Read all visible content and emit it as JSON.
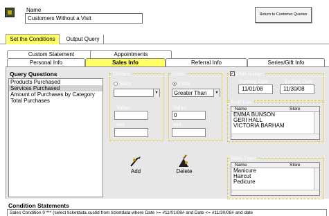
{
  "header": {
    "name_label": "Name",
    "name_value": "Customers Without a Visit",
    "return_button": "Return to Customer Queries"
  },
  "top_tabs": {
    "conditions": "Set the Conditions",
    "output": "Output Query"
  },
  "section_tabs": {
    "custom_statement": "Custom Statement",
    "appointments": "Appointments",
    "personal_info": "Personal Info",
    "sales_info": "Sales Info",
    "referral_info": "Referral Info",
    "series_gift_info": "Series/Gift Info"
  },
  "query_questions": {
    "title": "Query Questions",
    "items": [
      {
        "label": "Products Purchased",
        "selected": false
      },
      {
        "label": "Services Purchased",
        "selected": true
      },
      {
        "label": "Amount of Purchases by Category",
        "selected": false
      },
      {
        "label": "Total Purchases",
        "selected": false
      }
    ]
  },
  "dollars": {
    "title": "Dollars:",
    "radio_label": "Sales",
    "value_label": "Value:",
    "and_label": "and"
  },
  "units": {
    "title": "Units:",
    "radio_label": "Units",
    "operator": "Greater Than",
    "value_label": "Value:",
    "value": "0",
    "and_label": "and"
  },
  "date_range": {
    "title": "Date Range:",
    "checked": true,
    "start_label": "Starting Date",
    "end_label": "Ending Date",
    "start_value": "11/01/08",
    "end_value": "11/30/08"
  },
  "staff_list": {
    "title": "Staff List:",
    "columns": [
      "Name",
      "Store"
    ],
    "rows": [
      "EMMA BUNSON",
      "GERI HALL",
      "VICTORIA BARHAM"
    ]
  },
  "sales_type": {
    "title": "Sales Type:",
    "columns": [
      "Name",
      "Store"
    ],
    "rows": [
      "Manicure",
      "Haircut",
      "Pedicure"
    ]
  },
  "actions": {
    "add": "Add",
    "delete": "Delete"
  },
  "conditions": {
    "title": "Condition Statements",
    "statement": "Sales Condition 0 *** (select ticketdata.custid from ticketdata where  Date >= #11/01/08# and  Date <= #11/30/08# and  date"
  },
  "colors": {
    "tab_highlight": "#ffff66",
    "group_border": "#e0c000",
    "panel_bg": "#e7e7e7"
  }
}
